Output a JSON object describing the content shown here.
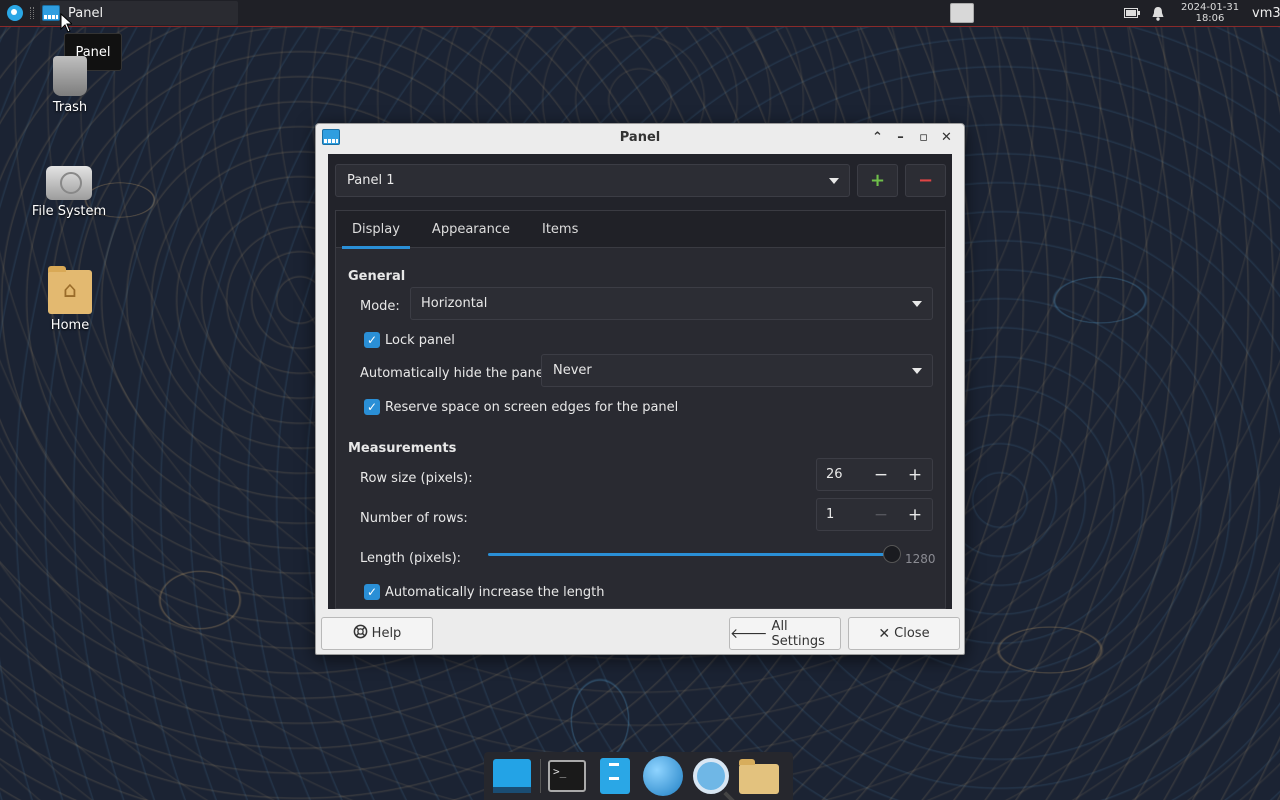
{
  "top_panel": {
    "task_label": "Panel",
    "tooltip": "Panel",
    "clock_date": "2024-01-31",
    "clock_time": "18:06",
    "user": "vm3"
  },
  "desktop": {
    "icons": [
      {
        "label": "Trash",
        "icon": "trash-icon"
      },
      {
        "label": "File System",
        "icon": "drive-icon"
      },
      {
        "label": "Home",
        "icon": "home-folder-icon"
      }
    ]
  },
  "dialog": {
    "title": "Panel",
    "panel_select": "Panel 1",
    "add_symbol": "+",
    "remove_symbol": "−",
    "tabs": [
      {
        "label": "Display"
      },
      {
        "label": "Appearance"
      },
      {
        "label": "Items"
      }
    ],
    "display": {
      "general_title": "General",
      "mode_label": "Mode:",
      "mode_value": "Horizontal",
      "lock_panel": "Lock panel",
      "autohide_label": "Automatically hide the panel:",
      "autohide_value": "Never",
      "reserve_space": "Reserve space on screen edges for the panel",
      "measurements_title": "Measurements",
      "row_size_label": "Row size (pixels):",
      "row_size_value": "26",
      "rows_label": "Number of rows:",
      "rows_value": "1",
      "length_label": "Length (pixels):",
      "length_value": "1280",
      "length_fraction": 1.0,
      "auto_length": "Automatically increase the length"
    },
    "buttons": {
      "help": "Help",
      "all_settings": "All Settings",
      "close": "Close"
    }
  },
  "colors": {
    "accent": "#2a8fd6",
    "add": "#6fbf4a",
    "remove": "#e04545"
  }
}
